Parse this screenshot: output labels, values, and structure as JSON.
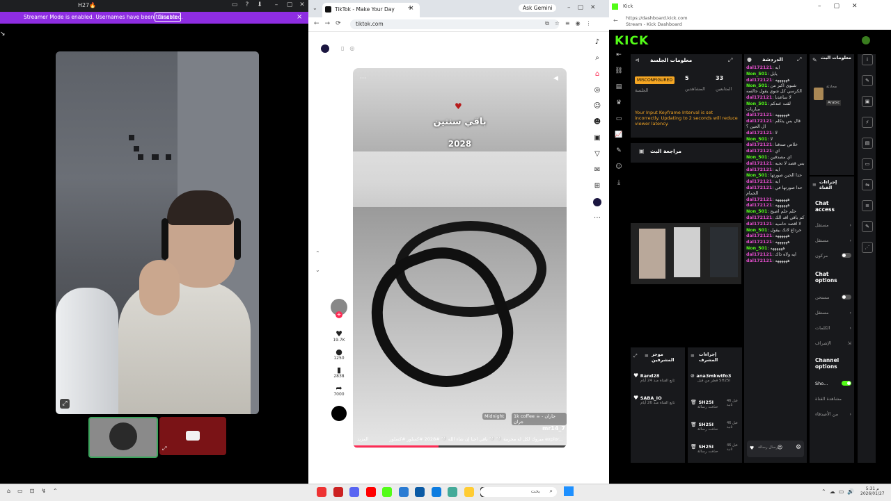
{
  "discord": {
    "window_title": "H27🔥",
    "streamer_banner": "Streamer Mode is enabled. Usernames have been truncated.",
    "disable_button": "Disable"
  },
  "browser": {
    "tab_title": "TikTok - Make Your Day",
    "gemini_button": "Ask Gemini",
    "url": "tiktok.com",
    "video": {
      "caption_line1": "باقي سنتين",
      "caption_line2": "2028",
      "music_label": "Midnight",
      "music_track": "1k coffee ☕ جاران - جران",
      "username": "mr14_7",
      "description": "مبروك لكل له محرمة 🤍 🤍 باقي احنا إن شاء الله 🤍 #2028 #كسلور #كسلور explor...",
      "more": "المزيد",
      "progress": 0.4
    },
    "actions": [
      {
        "icon": "heart-icon",
        "glyph": "♥",
        "count": "19.7K"
      },
      {
        "icon": "comment-icon",
        "glyph": "●",
        "count": "1250"
      },
      {
        "icon": "bookmark-icon",
        "glyph": "▮",
        "count": "2838"
      },
      {
        "icon": "share-icon",
        "glyph": "➦",
        "count": "7000"
      }
    ]
  },
  "kick": {
    "window_title": "Kick",
    "url_line1": "https://dashboard.kick.com",
    "url_line2": "Stream - Kick Dashboard",
    "logo": "KICK",
    "session": {
      "title": "معلومات الجلسة",
      "badge": "MISCONFIGURED",
      "badge_label": "الجلسة",
      "viewers_value": "5",
      "viewers_label": "المشاهدين",
      "followers_value": "33",
      "followers_label": "المتابعين",
      "warning": "Your Input Keyframe Interval is set incorrectly. Updating to 2 seconds will reduce viewer latency."
    },
    "review_title": "مراجعة البث",
    "chat_title": "الدردشة",
    "stream_info_title": "معلومات البث",
    "stream_info_sub": "محادثة",
    "stream_language": "Arabic",
    "chat_messages": [
      {
        "user": "dal172121",
        "text": "ايه",
        "color": "pink"
      },
      {
        "user": "Non_501",
        "text": "يايل",
        "color": "green"
      },
      {
        "user": "dal172121",
        "text": "ههههههه",
        "color": "pink"
      },
      {
        "user": "Non_501",
        "text": "شبوي اكبر من الكرسي كل شوي يقول جالسه",
        "color": "green"
      },
      {
        "user": "dal172121",
        "text": "لا ساعدنا",
        "color": "pink"
      },
      {
        "user": "Non_501",
        "text": "لقت عندكم مباريات",
        "color": "green"
      },
      {
        "user": "dal172121",
        "text": "ههههههه",
        "color": "pink"
      },
      {
        "user": "dal172121",
        "text": "قال بس يتكلم ال الحين ؟",
        "color": "pink"
      },
      {
        "user": "dal172121",
        "text": "لا",
        "color": "pink"
      },
      {
        "user": "Non_501",
        "text": "لا",
        "color": "green"
      },
      {
        "user": "dal172121",
        "text": "خلاص صدقنا",
        "color": "pink"
      },
      {
        "user": "dal172121",
        "text": "اي",
        "color": "pink"
      },
      {
        "user": "Non_501",
        "text": "اي مصدقين",
        "color": "green"
      },
      {
        "user": "dal172121",
        "text": "بس قصد لا تحبه",
        "color": "pink"
      },
      {
        "user": "dal172121",
        "text": "ايه",
        "color": "pink"
      },
      {
        "user": "Non_501",
        "text": "حدا الحين صورتها",
        "color": "green"
      },
      {
        "user": "dal172121",
        "text": "ايه",
        "color": "pink"
      },
      {
        "user": "dal172121",
        "text": "حدا صورتها في الحمام",
        "color": "pink"
      },
      {
        "user": "dal172121",
        "text": "ههههههه",
        "color": "pink"
      },
      {
        "user": "dal172121",
        "text": "ههههههه",
        "color": "pink"
      },
      {
        "user": "Non_501",
        "text": "حلم حلم اصبح",
        "color": "green"
      },
      {
        "user": "dal172121",
        "text": "كم باقي اقد الك",
        "color": "pink"
      },
      {
        "user": "dal172121",
        "text": "لا اقصد حاسيه",
        "color": "pink"
      },
      {
        "user": "Non_501",
        "text": "حرداع لانك بيقول",
        "color": "green"
      },
      {
        "user": "dal172121",
        "text": "ههههههه",
        "color": "pink"
      },
      {
        "user": "dal172121",
        "text": "ههههههه",
        "color": "pink"
      },
      {
        "user": "Non_501",
        "text": "ههههههه",
        "color": "green"
      },
      {
        "user": "dal172121",
        "text": "ايه ولاه ذاك",
        "color": "pink"
      },
      {
        "user": "dal172121",
        "text": "ههههههه",
        "color": "pink"
      }
    ],
    "quick_actions_title": "إجراءات القناة",
    "chat_access": "Chat access",
    "chat_options": "Chat options",
    "channel_options": "Channel options",
    "show_label": "Sho...",
    "action_rows": [
      "مستقل",
      "مستقل",
      "مركون"
    ],
    "option_rows": [
      "مستحن",
      "مستقل",
      "الكلمات",
      "الإشراف"
    ],
    "channel_rows": [
      "مشاهدة القناة",
      "من الأصدقاء"
    ],
    "mods_title": "موجز المشرفين",
    "mods": [
      {
        "name": "Rand28",
        "sub": "تابع القناة منذ 24 أيام"
      },
      {
        "name": "SABA_IO",
        "sub": "تابع القناة منذ 26 أيام"
      }
    ],
    "modact_title": "إجراءات المشرف",
    "modact": [
      {
        "name": "ana3mkwtfo3",
        "sub": "قطر من قبل SH25I",
        "time": ""
      },
      {
        "name": "SH25I",
        "sub": "حذفت رسالة",
        "time": "قبل 46 ثانية"
      },
      {
        "name": "SH25I",
        "sub": "حذفت رسالة",
        "time": "قبل 46 ثانية"
      },
      {
        "name": "SH25I",
        "sub": "حذفت رسالة",
        "time": "قبل 46 ثانية"
      }
    ],
    "chat_input_placeholder": "إرسال رسالة"
  },
  "taskbar": {
    "search_placeholder": "بحث",
    "clock_time": "5:31 م",
    "clock_date": "2026/01/27"
  }
}
